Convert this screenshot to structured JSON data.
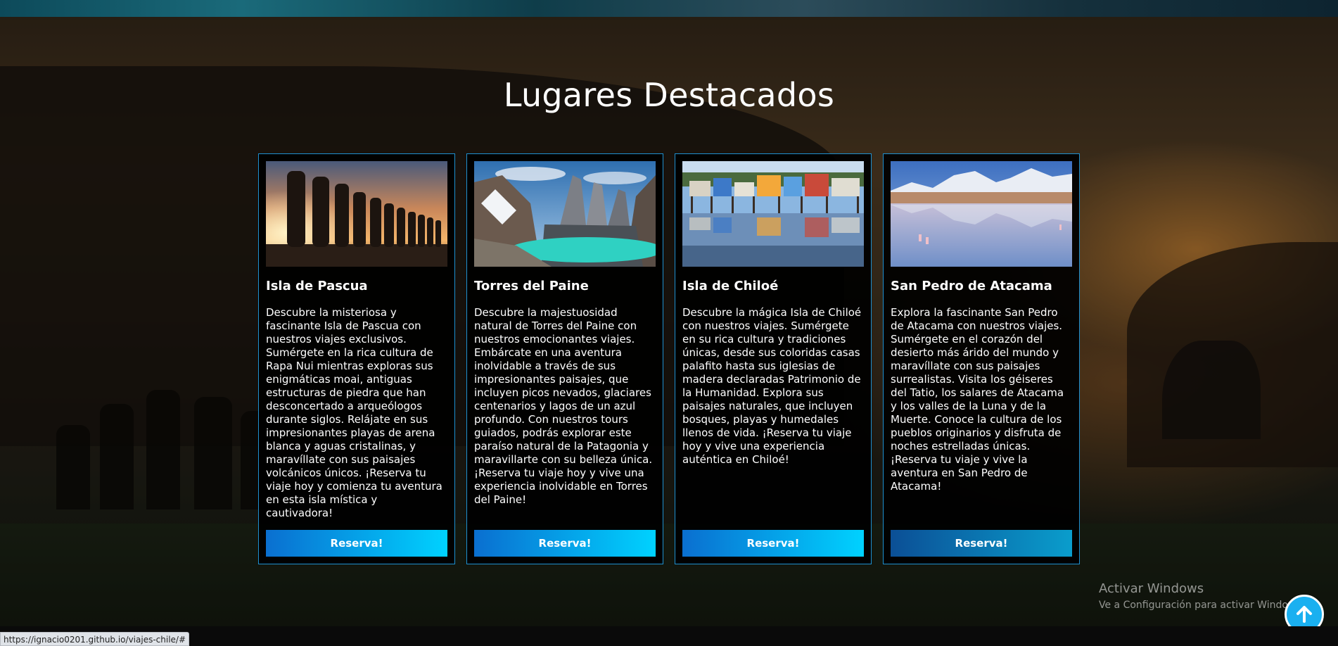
{
  "section": {
    "title": "Lugares Destacados"
  },
  "cards": [
    {
      "title": "Isla de Pascua",
      "text": "Descubre la misteriosa y fascinante Isla de Pascua con nuestros viajes exclusivos. Sumérgete en la rica cultura de Rapa Nui mientras exploras sus enigmáticas moai, antiguas estructuras de piedra que han desconcertado a arqueólogos durante siglos. Relájate en sus impresionantes playas de arena blanca y aguas cristalinas, y maravíllate con sus paisajes volcánicos únicos. ¡Reserva tu viaje hoy y comienza tu aventura en esta isla mística y cautivadora!",
      "button": "Reserva!"
    },
    {
      "title": "Torres del Paine",
      "text": "Descubre la majestuosidad natural de Torres del Paine con nuestros emocionantes viajes. Embárcate en una aventura inolvidable a través de sus impresionantes paisajes, que incluyen picos nevados, glaciares centenarios y lagos de un azul profundo. Con nuestros tours guiados, podrás explorar este paraíso natural de la Patagonia y maravillarte con su belleza única. ¡Reserva tu viaje hoy y vive una experiencia inolvidable en Torres del Paine!",
      "button": "Reserva!"
    },
    {
      "title": "Isla de Chiloé",
      "text": "Descubre la mágica Isla de Chiloé con nuestros viajes. Sumérgete en su rica cultura y tradiciones únicas, desde sus coloridas casas palafito hasta sus iglesias de madera declaradas Patrimonio de la Humanidad. Explora sus paisajes naturales, que incluyen bosques, playas y humedales llenos de vida. ¡Reserva tu viaje hoy y vive una experiencia auténtica en Chiloé!",
      "button": "Reserva!"
    },
    {
      "title": "San Pedro de Atacama",
      "text": "Explora la fascinante San Pedro de Atacama con nuestros viajes. Sumérgete en el corazón del desierto más árido del mundo y maravíllate con sus paisajes surrealistas. Visita los géiseres del Tatio, los salares de Atacama y los valles de la Luna y de la Muerte. Conoce la cultura de los pueblos originarios y disfruta de noches estrelladas únicas. ¡Reserva tu viaje y vive la aventura en San Pedro de Atacama!",
      "button": "Reserva!"
    }
  ],
  "windows_watermark": {
    "line1": "Activar Windows",
    "line2": "Ve a Configuración para activar Windows"
  },
  "status_bar": {
    "url": "https://ignacio0201.github.io/viajes-chile/#"
  },
  "colors": {
    "card_border": "#1e90d0",
    "button_gradient_start": "#0a6fd0",
    "button_gradient_end": "#00d2ff",
    "scroll_top_button": "#1ab0f0"
  },
  "icons": {
    "scroll_top": "arrow-up-icon"
  }
}
